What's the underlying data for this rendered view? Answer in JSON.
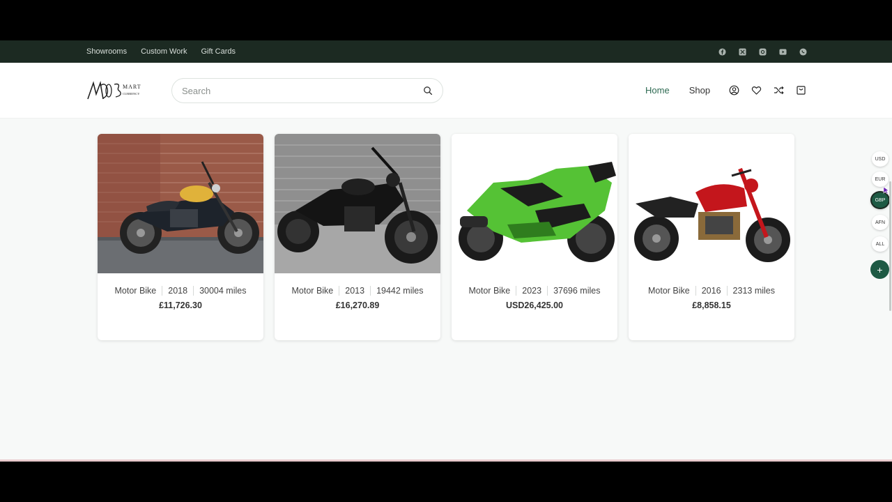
{
  "topbar": {
    "links": [
      "Showrooms",
      "Custom Work",
      "Gift Cards"
    ],
    "social_icons": [
      "facebook-icon",
      "x-icon",
      "instagram-icon",
      "youtube-icon",
      "whatsapp-icon"
    ]
  },
  "header": {
    "logo_text": "MOBSMART CURRENCY",
    "search_placeholder": "Search",
    "nav": [
      "Home",
      "Shop"
    ],
    "icons": [
      "account-icon",
      "wishlist-heart-icon",
      "compare-shuffle-icon",
      "cart-bag-icon"
    ]
  },
  "products": [
    {
      "type": "Motor Bike",
      "year": "2018",
      "miles": "30004 miles",
      "price": "£11,726.30"
    },
    {
      "type": "Motor Bike",
      "year": "2013",
      "miles": "19442 miles",
      "price": "£16,270.89"
    },
    {
      "type": "Motor Bike",
      "year": "2023",
      "miles": "37696 miles",
      "price": "USD26,425.00"
    },
    {
      "type": "Motor Bike",
      "year": "2016",
      "miles": "2313 miles",
      "price": "£8,858.15"
    }
  ],
  "currencies": [
    "USD",
    "EUR",
    "GBP",
    "AFN",
    "ALL"
  ],
  "active_currency": "GBP",
  "currency_add": "+",
  "colors": {
    "topbar_bg": "#1c2a22",
    "accent": "#1e5a44",
    "page_bg": "#f7f9f8"
  }
}
